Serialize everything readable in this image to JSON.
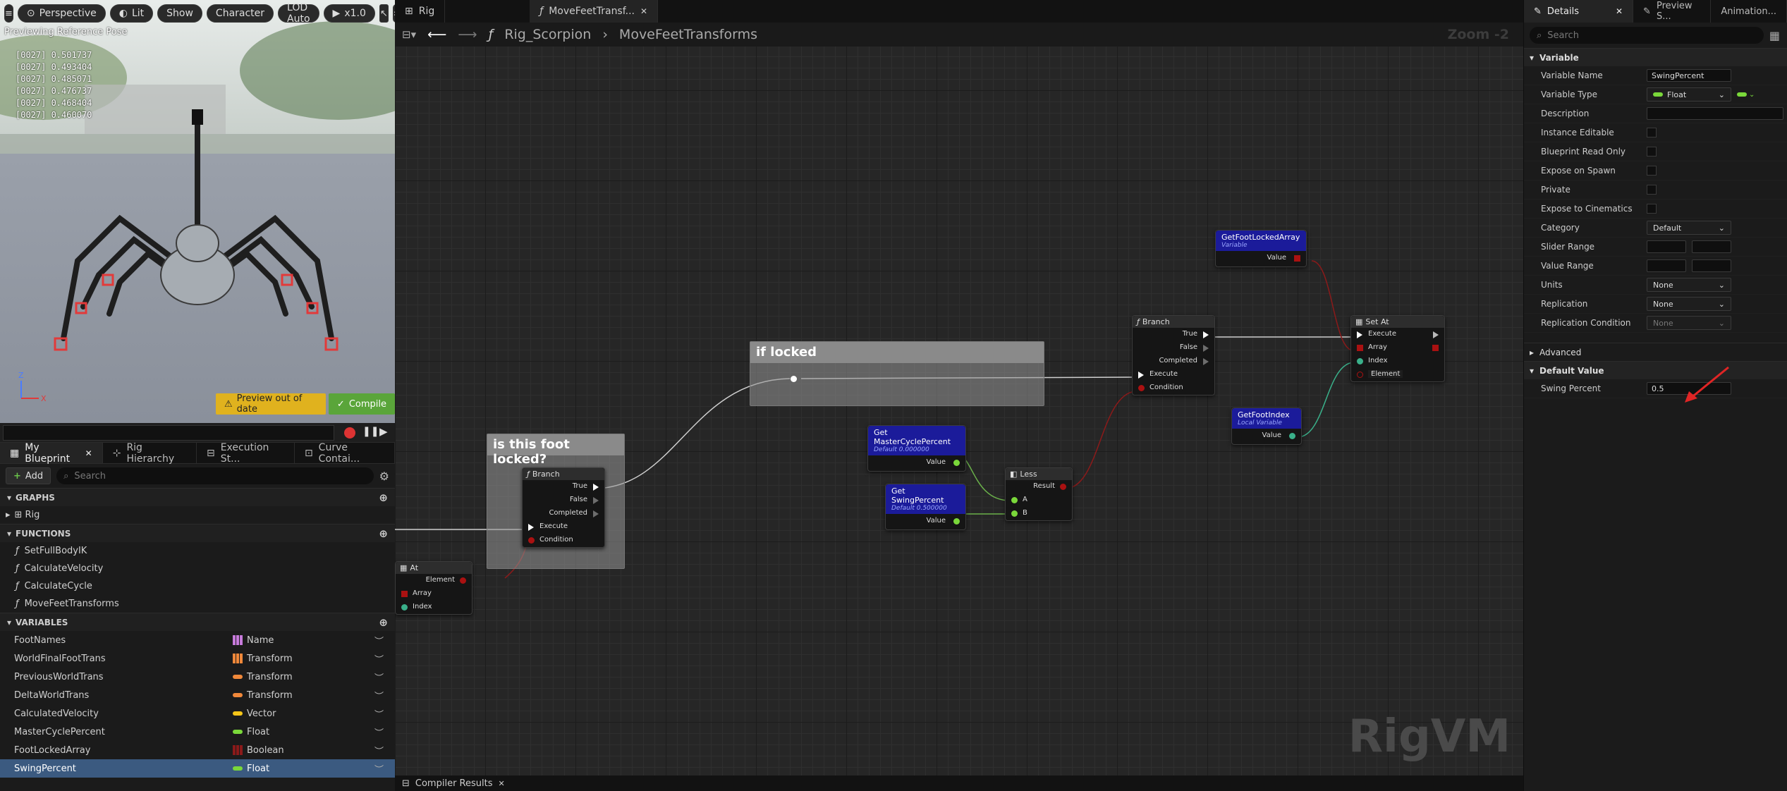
{
  "viewport": {
    "toolbar": {
      "perspective": "Perspective",
      "lit": "Lit",
      "show": "Show",
      "character": "Character",
      "lod": "LOD Auto",
      "speed": "x1.0"
    },
    "preview_label": "Previewing Reference Pose",
    "debug_lines": [
      "[0027] 0.501737",
      "[0027] 0.493404",
      "[0027] 0.485071",
      "[0027] 0.476737",
      "[0027] 0.468404",
      "[0027] 0.460070"
    ],
    "preview_out_of_date": "Preview out of date",
    "compile": "Compile"
  },
  "left_panel": {
    "tabs": [
      "My Blueprint",
      "Rig Hierarchy",
      "Execution St...",
      "Curve Contai..."
    ],
    "add_label": "Add",
    "search_placeholder": "Search",
    "graphs_header": "GRAPHS",
    "graphs": [
      "Rig"
    ],
    "functions_header": "FUNCTIONS",
    "functions": [
      "SetFullBodyIK",
      "CalculateVelocity",
      "CalculateCycle",
      "MoveFeetTransforms"
    ],
    "variables_header": "VARIABLES",
    "variables": [
      {
        "name": "FootNames",
        "type": "Name",
        "color": "#c77bdb"
      },
      {
        "name": "WorldFinalFootTrans",
        "type": "Transform",
        "color": "#f0883a"
      },
      {
        "name": "PreviousWorldTrans",
        "type": "Transform",
        "color": "#f0883a"
      },
      {
        "name": "DeltaWorldTrans",
        "type": "Transform",
        "color": "#f0883a"
      },
      {
        "name": "CalculatedVelocity",
        "type": "Vector",
        "color": "#f5c518"
      },
      {
        "name": "MasterCyclePercent",
        "type": "Float",
        "color": "#7ad83a"
      },
      {
        "name": "FootLockedArray",
        "type": "Boolean",
        "color": "#8b1a1a"
      },
      {
        "name": "SwingPercent",
        "type": "Float",
        "color": "#7ad83a"
      }
    ]
  },
  "graph": {
    "tabs": [
      "Rig",
      "MoveFeetTransf..."
    ],
    "breadcrumb": [
      "Rig_Scorpion",
      "MoveFeetTransforms"
    ],
    "zoom": "Zoom -2",
    "watermark": "RigVM",
    "bottom_tab": "Compiler Results",
    "comments": {
      "locked": "if locked",
      "foot_locked": "is this foot locked?"
    },
    "nodes": {
      "branch1": {
        "title": "Branch",
        "pins": [
          "True",
          "False",
          "Completed",
          "Execute",
          "Condition"
        ]
      },
      "branch2": {
        "title": "Branch",
        "pins": [
          "True",
          "False",
          "Completed",
          "Execute",
          "Condition"
        ]
      },
      "at": {
        "title": "At",
        "pins": [
          "Element",
          "Array",
          "Index"
        ]
      },
      "get_master": {
        "title": "Get MasterCyclePercent",
        "sub": "Default 0.000000",
        "pin": "Value"
      },
      "get_swing": {
        "title": "Get SwingPercent",
        "sub": "Default 0.500000",
        "pin": "Value"
      },
      "less": {
        "title": "Less",
        "pins": [
          "Result",
          "A",
          "B"
        ]
      },
      "get_foot_locked": {
        "title": "GetFootLockedArray",
        "sub": "Variable",
        "pin": "Value"
      },
      "get_foot_index": {
        "title": "GetFootIndex",
        "sub": "Local Variable",
        "pin": "Value"
      },
      "set_at": {
        "title": "Set At",
        "pins": [
          "Execute",
          "Array",
          "Index",
          "Element"
        ]
      }
    }
  },
  "details": {
    "tabs": [
      "Details",
      "Preview S...",
      "Animation..."
    ],
    "search_placeholder": "Search",
    "variable_header": "Variable",
    "rows": [
      {
        "label": "Variable Name",
        "value": "SwingPercent",
        "kind": "input"
      },
      {
        "label": "Variable Type",
        "value": "Float",
        "kind": "type"
      },
      {
        "label": "Description",
        "value": "",
        "kind": "input"
      },
      {
        "label": "Instance Editable",
        "kind": "check"
      },
      {
        "label": "Blueprint Read Only",
        "kind": "check"
      },
      {
        "label": "Expose on Spawn",
        "kind": "check"
      },
      {
        "label": "Private",
        "kind": "check"
      },
      {
        "label": "Expose to Cinematics",
        "kind": "check"
      },
      {
        "label": "Category",
        "value": "Default",
        "kind": "dropdown"
      },
      {
        "label": "Slider Range",
        "kind": "range"
      },
      {
        "label": "Value Range",
        "kind": "range"
      },
      {
        "label": "Units",
        "value": "None",
        "kind": "dropdown"
      },
      {
        "label": "Replication",
        "value": "None",
        "kind": "dropdown"
      },
      {
        "label": "Replication Condition",
        "value": "None",
        "kind": "dropdown"
      }
    ],
    "advanced": "Advanced",
    "default_value_header": "Default Value",
    "swing_label": "Swing Percent",
    "swing_value": "0.5"
  }
}
